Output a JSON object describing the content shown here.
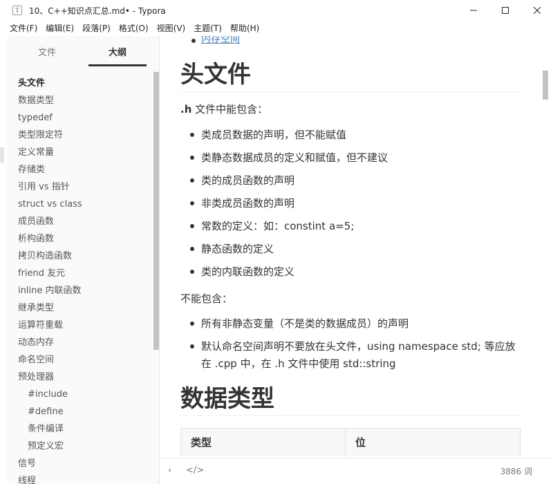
{
  "window": {
    "app_icon": "T",
    "title": "10、C++知识点汇总.md• - Typora"
  },
  "menu": [
    "文件(F)",
    "编辑(E)",
    "段落(P)",
    "格式(O)",
    "视图(V)",
    "主题(T)",
    "帮助(H)"
  ],
  "sidebar": {
    "tabs": {
      "files": "文件",
      "outline": "大纲"
    },
    "items": [
      {
        "label": "头文件",
        "level": 1,
        "active": true
      },
      {
        "label": "数据类型",
        "level": 1
      },
      {
        "label": "typedef",
        "level": 1
      },
      {
        "label": "类型限定符",
        "level": 1
      },
      {
        "label": "定义常量",
        "level": 1
      },
      {
        "label": "存储类",
        "level": 1
      },
      {
        "label": "引用 vs 指针",
        "level": 1
      },
      {
        "label": "struct vs class",
        "level": 1
      },
      {
        "label": "成员函数",
        "level": 1
      },
      {
        "label": "析构函数",
        "level": 1
      },
      {
        "label": "拷贝构造函数",
        "level": 1
      },
      {
        "label": "friend 友元",
        "level": 1
      },
      {
        "label": "inline 内联函数",
        "level": 1
      },
      {
        "label": "继承类型",
        "level": 1
      },
      {
        "label": "运算符重载",
        "level": 1
      },
      {
        "label": "动态内存",
        "level": 1
      },
      {
        "label": "命名空间",
        "level": 1
      },
      {
        "label": "预处理器",
        "level": 1
      },
      {
        "label": "#include",
        "level": 2
      },
      {
        "label": "#define",
        "level": 2
      },
      {
        "label": "条件编译",
        "level": 2
      },
      {
        "label": "预定义宏",
        "level": 2
      },
      {
        "label": "信号",
        "level": 1
      },
      {
        "label": "线程",
        "level": 1
      }
    ]
  },
  "doc": {
    "top_link": "内存空间",
    "h1_a": "头文件",
    "p1_bold": ".h",
    "p1_rest": " 文件中能包含：",
    "list1": [
      "类成员数据的声明，但不能赋值",
      "类静态数据成员的定义和赋值，但不建议",
      "类的成员函数的声明",
      "非类成员函数的声明",
      "常数的定义：如：constint a=5;",
      "静态函数的定义",
      "类的内联函数的定义"
    ],
    "p2": "不能包含：",
    "list2": [
      "所有非静态变量（不是类的数据成员）的声明",
      "默认命名空间声明不要放在头文件，using namespace std; 等应放在 .cpp 中，在 .h 文件中使用 std::string"
    ],
    "h1_b": "数据类型",
    "table_headers": [
      "类型",
      "位"
    ]
  },
  "footer": {
    "back_icon": "‹",
    "source_icon": "</>",
    "word_count": "3886 词"
  }
}
